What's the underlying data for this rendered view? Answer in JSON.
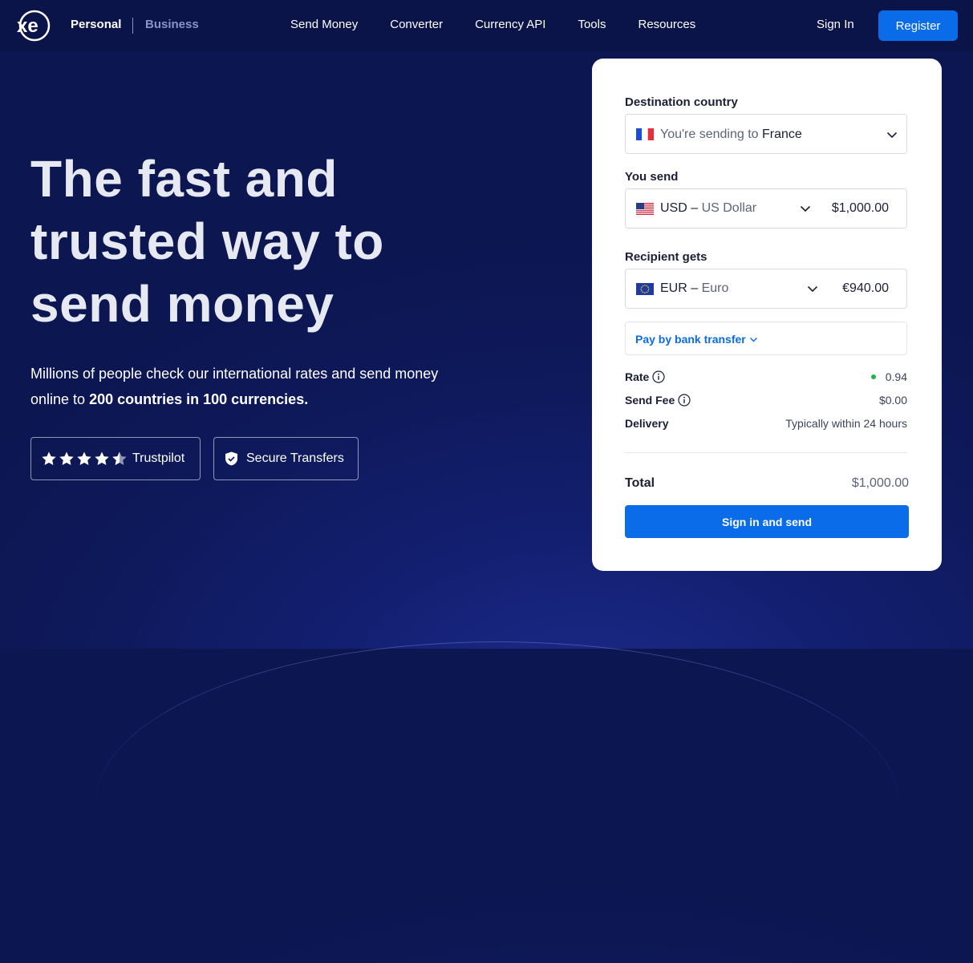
{
  "colors": {
    "brand_blue": "#0a6ce8",
    "nav_bg": "#0b1448",
    "hero_bg": "#0f1a5e",
    "rate_dot": "#22b14c"
  },
  "nav": {
    "logo_text": "xe",
    "personal": "Personal",
    "business": "Business",
    "links": [
      "Send Money",
      "Converter",
      "Currency API",
      "Tools",
      "Resources"
    ],
    "signin": "Sign In",
    "register": "Register"
  },
  "hero": {
    "title_line1": "The fast and",
    "title_line2": "trusted way to",
    "title_line3": "send money",
    "sub_plain": "Millions of people check our international rates and send money online to ",
    "sub_bold": "200 countries in 100 currencies.",
    "badges": {
      "trustpilot": "Trustpilot",
      "trustpilot_stars": 4.5,
      "secure": "Secure Transfers"
    }
  },
  "form": {
    "destination_label": "Destination country",
    "destination_prefix": "You're sending to",
    "destination_country": "France",
    "send_label": "You send",
    "send_code": "USD –",
    "send_name": "US Dollar",
    "send_amount": "$1,000.00",
    "recipient_label": "Recipient gets",
    "recipient_code": "EUR –",
    "recipient_name": "Euro",
    "recipient_amount": "€940.00",
    "pay_method": "Pay by bank transfer",
    "rate_label": "Rate",
    "rate_value": "0.94",
    "fee_label": "Send Fee",
    "fee_value": "$0.00",
    "delivery_label": "Delivery",
    "delivery_value": "Typically within 24 hours",
    "total_label": "Total",
    "total_value": "$1,000.00",
    "submit": "Sign in and send"
  },
  "icons": {
    "chevron": "chevron-down-icon",
    "info": "info-icon",
    "shield": "shield-icon",
    "star": "star-icon",
    "flag_fr": "france-flag-icon",
    "flag_us": "us-flag-icon",
    "flag_eu": "eu-flag-icon"
  }
}
